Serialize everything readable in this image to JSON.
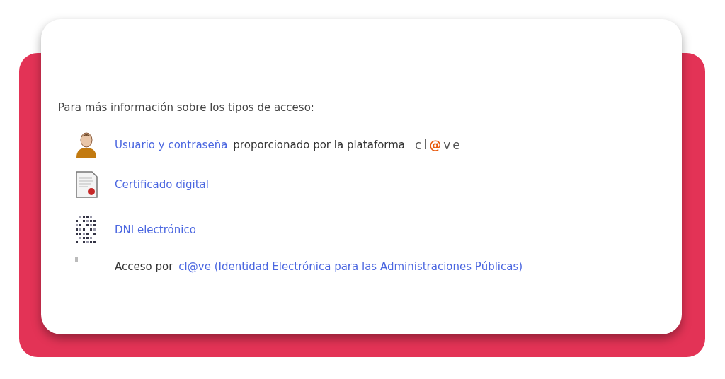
{
  "intro": "Para más información sobre los tipos de acceso:",
  "items": [
    {
      "kind": "user",
      "segments": [
        {
          "text": "Usuario y contraseña",
          "link": true
        },
        {
          "text": "proporcionado por la plataforma",
          "link": false
        }
      ],
      "logo": [
        "cl",
        "@",
        "ve"
      ]
    },
    {
      "kind": "certificate",
      "segments": [
        {
          "text": "Certificado digital",
          "link": true
        }
      ]
    },
    {
      "kind": "dni",
      "segments": [
        {
          "text": "DNI electrónico",
          "link": true
        }
      ]
    },
    {
      "kind": "bullet",
      "segments": [
        {
          "text": "Acceso por",
          "link": false
        },
        {
          "text": "cl@ve (Identidad Electrónica para las Administraciones Públicas)",
          "link": true
        }
      ]
    }
  ]
}
